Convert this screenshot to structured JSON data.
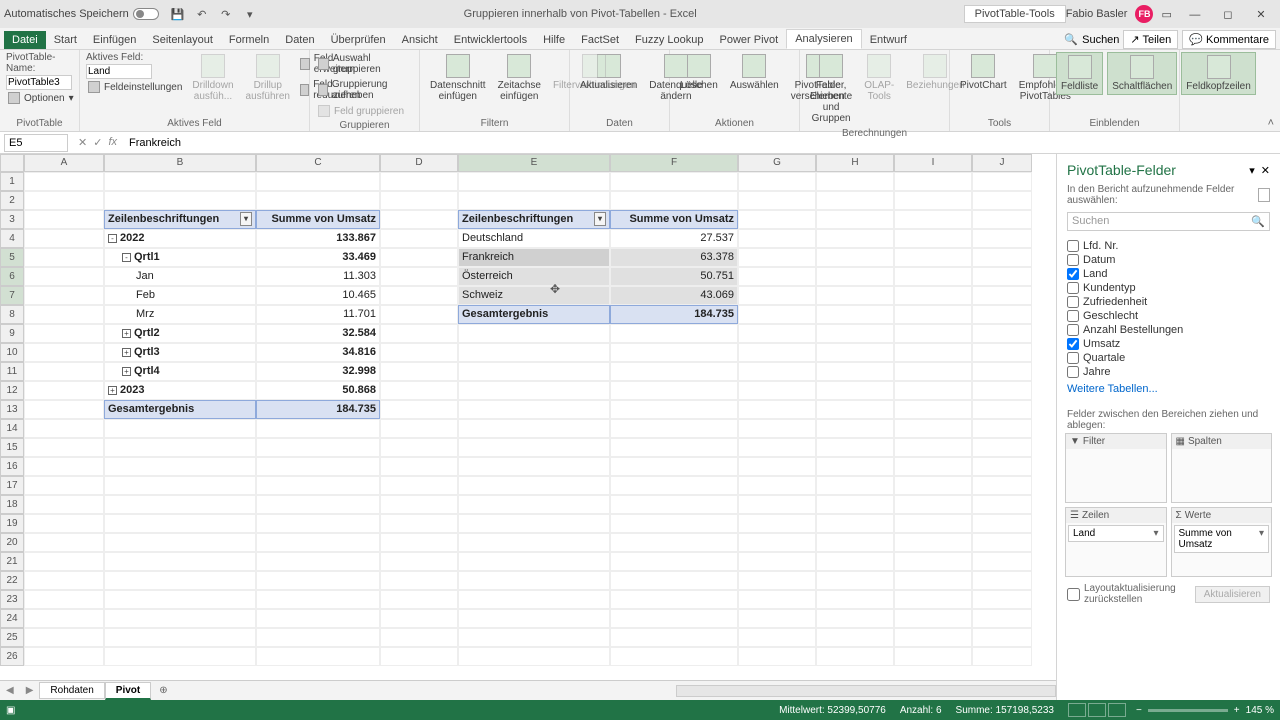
{
  "titlebar": {
    "autosave": "Automatisches Speichern",
    "doc": "Gruppieren innerhalb von Pivot-Tabellen",
    "appname": "Excel",
    "context_tool": "PivotTable-Tools",
    "username": "Fabio Basler",
    "avatar": "FB"
  },
  "tabs": {
    "file": "Datei",
    "items": [
      "Start",
      "Einfügen",
      "Seitenlayout",
      "Formeln",
      "Daten",
      "Überprüfen",
      "Ansicht",
      "Entwicklertools",
      "Hilfe",
      "FactSet",
      "Fuzzy Lookup",
      "Power Pivot",
      "Analysieren",
      "Entwurf"
    ],
    "active": "Analysieren",
    "search": "Suchen",
    "share": "Teilen",
    "comments": "Kommentare"
  },
  "ribbon": {
    "pivot_name_label": "PivotTable-Name:",
    "pivot_name_value": "PivotTable3",
    "options": "Optionen",
    "group1_label": "PivotTable",
    "active_field_label": "Aktives Feld:",
    "active_field_value": "Land",
    "field_settings": "Feldeinstellungen",
    "drilldown": "Drilldown ausfüh...",
    "drillup": "Drillup ausführen",
    "expand_field": "Feld erweitern",
    "collapse_field": "Feld reduzieren",
    "group2_label": "Aktives Feld",
    "group_selection": "Auswahl gruppieren",
    "ungroup": "Gruppierung aufheben",
    "group_field": "Feld gruppieren",
    "group3_label": "Gruppieren",
    "insert_slicer": "Datenschnitt einfügen",
    "insert_timeline": "Zeitachse einfügen",
    "filter_conn": "Filterverbindungen",
    "group4_label": "Filtern",
    "refresh": "Aktualisieren",
    "change_source": "Datenquelle ändern",
    "group5_label": "Daten",
    "clear": "Löschen",
    "select": "Auswählen",
    "move": "PivotTable verschieben",
    "group6_label": "Aktionen",
    "calc_items": "Felder, Elemente und Gruppen",
    "olap": "OLAP-Tools",
    "relations": "Beziehungen",
    "group7_label": "Berechnungen",
    "pivotchart": "PivotChart",
    "recommended": "Empfohlene PivotTables",
    "group8_label": "Tools",
    "fieldlist": "Feldliste",
    "buttons": "Schaltflächen",
    "headers": "Feldkopfzeilen",
    "group9_label": "Einblenden"
  },
  "formulabar": {
    "cellref": "E5",
    "value": "Frankreich"
  },
  "columns": [
    "A",
    "B",
    "C",
    "D",
    "E",
    "F",
    "G",
    "H",
    "I",
    "J"
  ],
  "pivot1": {
    "header_rows": "Zeilenbeschriftungen",
    "header_vals": "Summe von Umsatz",
    "rows": [
      {
        "label": "2022",
        "value": "133.867",
        "expand": "-",
        "indent": 0,
        "bold": true
      },
      {
        "label": "Qrtl1",
        "value": "33.469",
        "expand": "-",
        "indent": 1,
        "bold": true
      },
      {
        "label": "Jan",
        "value": "11.303",
        "indent": 2
      },
      {
        "label": "Feb",
        "value": "10.465",
        "indent": 2
      },
      {
        "label": "Mrz",
        "value": "11.701",
        "indent": 2
      },
      {
        "label": "Qrtl2",
        "value": "32.584",
        "expand": "+",
        "indent": 1,
        "bold": true
      },
      {
        "label": "Qrtl3",
        "value": "34.816",
        "expand": "+",
        "indent": 1,
        "bold": true
      },
      {
        "label": "Qrtl4",
        "value": "32.998",
        "expand": "+",
        "indent": 1,
        "bold": true
      },
      {
        "label": "2023",
        "value": "50.868",
        "expand": "+",
        "indent": 0,
        "bold": true
      }
    ],
    "total_label": "Gesamtergebnis",
    "total_value": "184.735"
  },
  "pivot2": {
    "header_rows": "Zeilenbeschriftungen",
    "header_vals": "Summe von Umsatz",
    "rows": [
      {
        "label": "Deutschland",
        "value": "27.537"
      },
      {
        "label": "Frankreich",
        "value": "63.378",
        "sel": true
      },
      {
        "label": "Österreich",
        "value": "50.751",
        "sel": true
      },
      {
        "label": "Schweiz",
        "value": "43.069",
        "sel": true
      }
    ],
    "total_label": "Gesamtergebnis",
    "total_value": "184.735"
  },
  "taskpane": {
    "title": "PivotTable-Felder",
    "subtitle": "In den Bericht aufzunehmende Felder auswählen:",
    "search_placeholder": "Suchen",
    "fields": [
      {
        "name": "Lfd. Nr.",
        "checked": false
      },
      {
        "name": "Datum",
        "checked": false
      },
      {
        "name": "Land",
        "checked": true
      },
      {
        "name": "Kundentyp",
        "checked": false
      },
      {
        "name": "Zufriedenheit",
        "checked": false
      },
      {
        "name": "Geschlecht",
        "checked": false
      },
      {
        "name": "Anzahl Bestellungen",
        "checked": false
      },
      {
        "name": "Umsatz",
        "checked": true
      },
      {
        "name": "Quartale",
        "checked": false
      },
      {
        "name": "Jahre",
        "checked": false
      }
    ],
    "more_tables": "Weitere Tabellen...",
    "drag_label": "Felder zwischen den Bereichen ziehen und ablegen:",
    "area_filter": "Filter",
    "area_columns": "Spalten",
    "area_rows": "Zeilen",
    "area_values": "Werte",
    "row_item": "Land",
    "value_item": "Summe von Umsatz",
    "defer": "Layoutaktualisierung zurückstellen",
    "update": "Aktualisieren"
  },
  "sheets": {
    "tab1": "Rohdaten",
    "tab2": "Pivot"
  },
  "status": {
    "avg_label": "Mittelwert:",
    "avg": "52399,50776",
    "count_label": "Anzahl:",
    "count": "6",
    "sum_label": "Summe:",
    "sum": "157198,5233",
    "zoom": "145 %"
  }
}
